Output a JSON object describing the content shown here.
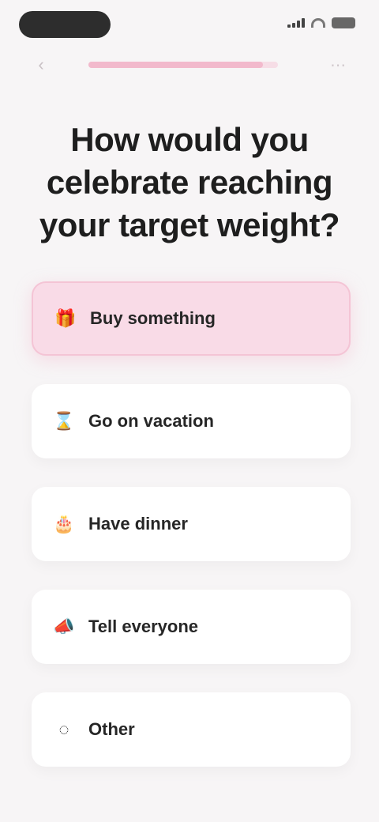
{
  "status_bar": {
    "signal": "signal-icon",
    "wifi": "wifi-icon",
    "battery": "battery-icon"
  },
  "nav": {
    "back_icon": "chevron-left-icon",
    "menu_icon": "more-icon",
    "progress_fraction": 0.92
  },
  "question": {
    "title": "How would you celebrate reaching your target weight?"
  },
  "options": [
    {
      "icon": "gift-icon",
      "label": "Buy something",
      "selected": true
    },
    {
      "icon": "hourglass-icon",
      "label": "Go on vacation",
      "selected": false
    },
    {
      "icon": "cake-icon",
      "label": "Have dinner",
      "selected": false
    },
    {
      "icon": "megaphone-icon",
      "label": "Tell everyone",
      "selected": false
    },
    {
      "icon": "other-icon",
      "label": "Other",
      "selected": false
    }
  ],
  "colors": {
    "accent": "#f2b9cc",
    "selected_bg": "#f9dbe7",
    "page_bg": "#f7f5f6"
  }
}
